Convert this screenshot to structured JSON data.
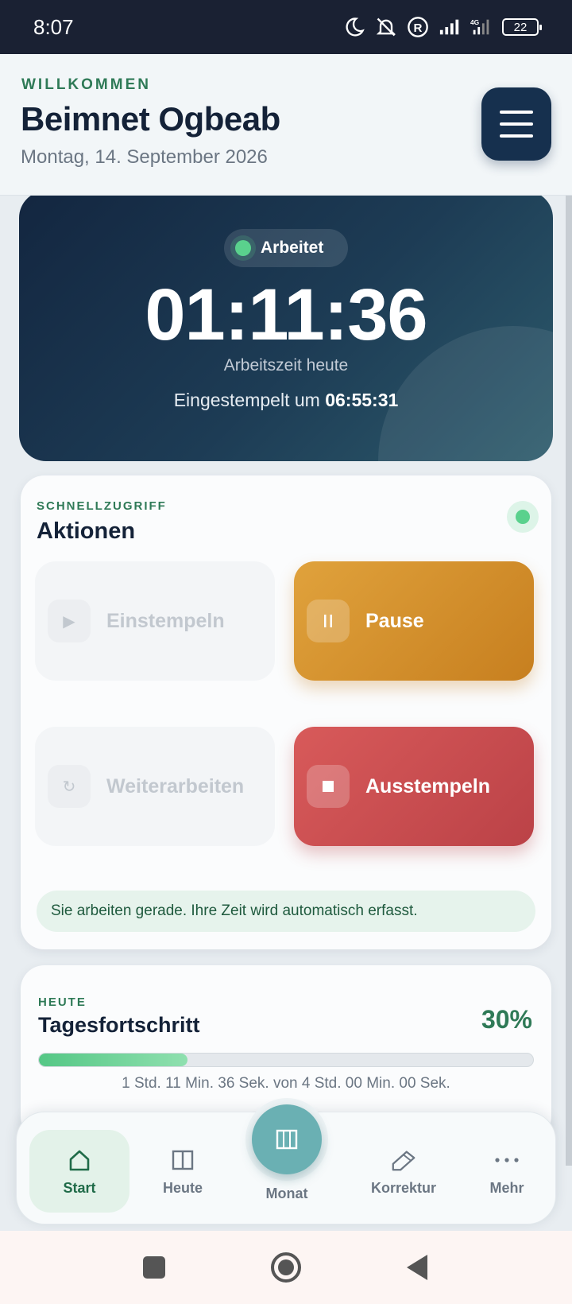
{
  "status_bar": {
    "time": "8:07",
    "battery": "22"
  },
  "header": {
    "welcome": "WILLKOMMEN",
    "user_name": "Beimnet Ogbeab",
    "date": "Montag, 14. September 2026"
  },
  "timer": {
    "status": "Arbeitet",
    "value": "01:11:36",
    "label": "Arbeitszeit heute",
    "clockin_prefix": "Eingestempelt um",
    "clockin_time": "06:55:31"
  },
  "actions": {
    "kicker": "SCHNELLZUGRIFF",
    "title": "Aktionen",
    "buttons": {
      "clock_in": "Einstempeln",
      "pause": "Pause",
      "resume": "Weiterarbeiten",
      "clock_out": "Ausstempeln"
    },
    "info": "Sie arbeiten gerade. Ihre Zeit wird automatisch erfasst."
  },
  "progress": {
    "kicker": "HEUTE",
    "title": "Tagesfortschritt",
    "percent_label": "30%",
    "percent": 30,
    "detail": "1 Std. 11 Min. 36 Sek. von 4 Std. 00 Min. 00 Sek."
  },
  "nav": {
    "start": "Start",
    "today": "Heute",
    "month": "Monat",
    "correction": "Korrektur",
    "more": "Mehr"
  },
  "colors": {
    "accent_green": "#2f7a57",
    "navy": "#16304e",
    "pause": "#d6922f",
    "stop": "#c94c50",
    "fab": "#6ab0b3"
  }
}
